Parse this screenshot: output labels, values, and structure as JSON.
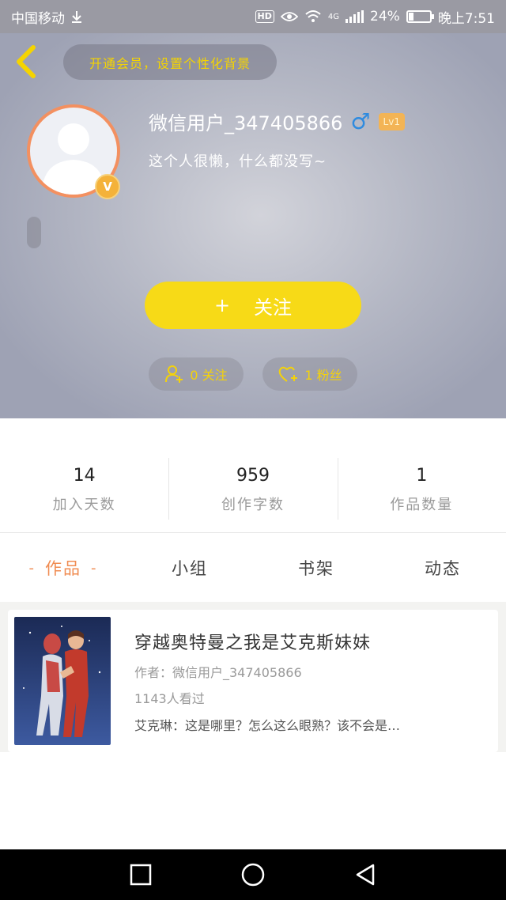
{
  "status_bar": {
    "carrier": "中国移动",
    "hd": "HD",
    "network": "4G",
    "battery": "24%",
    "battery_level": 0.24,
    "time": "晚上7:51"
  },
  "header": {
    "vip_banner": "开通会员，设置个性化背景",
    "username": "微信用户_347405866",
    "level": "Lv1",
    "bio": "这个人很懒，什么都没写~",
    "verified_badge": "V",
    "follow_plus": "+",
    "follow_label": "关注",
    "following_label": "0 关注",
    "fans_label": "1 粉丝",
    "accent_color": "#f7da17"
  },
  "stats": [
    {
      "value": "14",
      "label": "加入天数"
    },
    {
      "value": "959",
      "label": "创作字数"
    },
    {
      "value": "1",
      "label": "作品数量"
    }
  ],
  "tabs": [
    {
      "label": "作品",
      "active": true
    },
    {
      "label": "小组",
      "active": false
    },
    {
      "label": "书架",
      "active": false
    },
    {
      "label": "动态",
      "active": false
    }
  ],
  "works": [
    {
      "title": "穿越奥特曼之我是艾克斯妹妹",
      "author": "作者：微信用户_347405866",
      "views": "1143人看过",
      "excerpt": "艾克琳：这是哪里？怎么这么眼熟？该不会是…"
    }
  ],
  "icons": {
    "back": "chevron-left-icon",
    "gender": "male-icon",
    "following": "person-plus-icon",
    "fans": "heart-plus-icon",
    "nav": [
      "recent-apps-icon",
      "home-icon",
      "back-triangle-icon"
    ]
  }
}
